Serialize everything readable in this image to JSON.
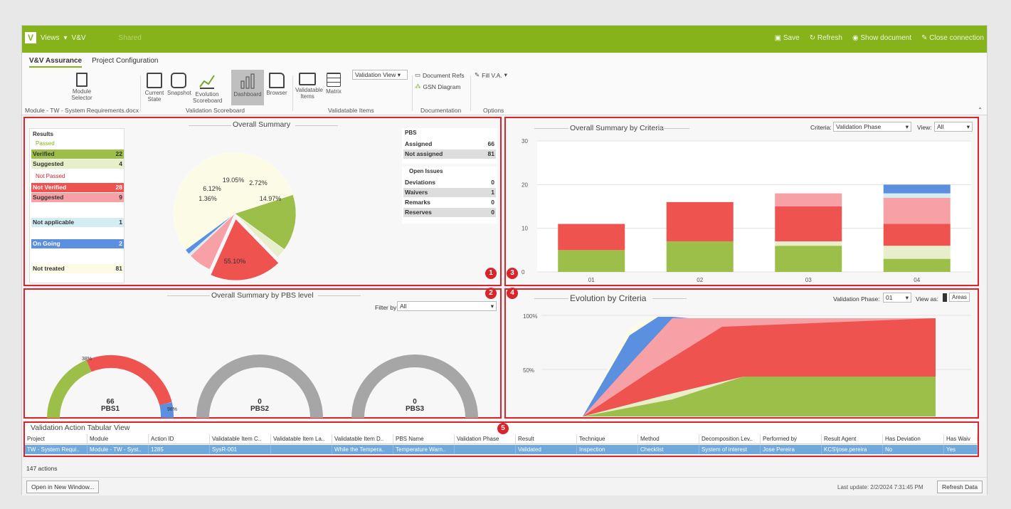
{
  "titlebar": {
    "app_menu": "Views",
    "context": "V&V",
    "shared": "Shared",
    "actions": [
      "Save",
      "Refresh",
      "Show document",
      "Close connection"
    ]
  },
  "ribbon": {
    "tabs": [
      "V&V Assurance",
      "Project Configuration"
    ],
    "module_selector": "Module Selector",
    "module_path": "Module - TW - System Requirements.docx",
    "scoreboard_buttons": [
      "Current State",
      "Snapshot",
      "Evolution Scoreboard",
      "Dashboard",
      "Browser"
    ],
    "scoreboard_group": "Validation Scoreboard",
    "items_buttons": [
      "Validatable Items",
      "Matrix"
    ],
    "items_dropdown": "Validation View",
    "items_group": "Validatable Items",
    "doc_buttons": [
      "Document Refs",
      "GSN Diagram"
    ],
    "doc_group": "Documentation",
    "options_button": "Fill V.A.",
    "options_group": "Options"
  },
  "panel1": {
    "title": "Overall Summary",
    "results_header": "Results",
    "passed_label": "Passed",
    "not_passed_label": "Not Passed",
    "rows": [
      {
        "label": "Verified",
        "value": "22",
        "color": "#9cbf4a"
      },
      {
        "label": "Suggested",
        "value": "4",
        "color": "#e6efc9"
      },
      {
        "label": "Not Verified",
        "value": "28",
        "color": "#ef5350"
      },
      {
        "label": "Suggested",
        "value": "9",
        "color": "#f7a0a6"
      },
      {
        "label": "Not applicable",
        "value": "1",
        "color": "#d4ecf3"
      },
      {
        "label": "On Going",
        "value": "2",
        "color": "#5b8fe0"
      },
      {
        "label": "Not treated",
        "value": "81",
        "color": "#fbfbe6"
      }
    ],
    "pie_labels": [
      "19.05%",
      "2.72%",
      "14.97%",
      "6.12%",
      "1.36%",
      "55.10%"
    ],
    "pbs_header": "PBS",
    "pbs_rows": [
      {
        "label": "Assigned",
        "value": "66"
      },
      {
        "label": "Not assigned",
        "value": "81"
      }
    ],
    "issues_header": "Open Issues",
    "issue_rows": [
      {
        "label": "Deviations",
        "value": "0"
      },
      {
        "label": "Waivers",
        "value": "1"
      },
      {
        "label": "Remarks",
        "value": "0"
      },
      {
        "label": "Reserves",
        "value": "0"
      }
    ]
  },
  "panel2": {
    "title": "Overall Summary by PBS level",
    "filter_label": "Filter by:",
    "filter_value": "All",
    "gauges": [
      {
        "value": "66",
        "name": "PBS1",
        "top_pct": "38%",
        "side_pct": "98%"
      },
      {
        "value": "0",
        "name": "PBS2"
      },
      {
        "value": "0",
        "name": "PBS3"
      }
    ]
  },
  "panel3": {
    "title": "Overall Summary by Criteria",
    "criteria_label": "Criteria:",
    "criteria_value": "Validation Phase",
    "view_label": "View:",
    "view_value": "All",
    "yticks": [
      "30",
      "20",
      "10",
      "0"
    ],
    "xcats": [
      "01",
      "02",
      "03",
      "04"
    ]
  },
  "panel4": {
    "title": "Evolution by Criteria",
    "phase_label": "Validation Phase:",
    "phase_value": "01",
    "viewas_label": "View as:",
    "viewas_value": "Areas",
    "yticks": [
      "100%",
      "50%"
    ]
  },
  "panel5": {
    "title": "Validation Action Tabular View",
    "columns": [
      "Project",
      "Module",
      "Action ID",
      "Validatable Item C..",
      "Validatable Item La..",
      "Validatable Item D..",
      "PBS Name",
      "Validation Phase",
      "Result",
      "Technique",
      "Method",
      "Decomposition Lev..",
      "Performed by",
      "Result Agent",
      "Has Deviation",
      "Has Waiv"
    ],
    "row": [
      "TW - System Requi..",
      "Module - TW - Syst..",
      "1285",
      "SysR-001",
      "",
      "While the Tempera..",
      "Temperature Warn..",
      "",
      "Validated",
      "Inspection",
      "Checklist",
      "System of interest",
      "Jose Pereira",
      "KCS\\jose.pereira",
      "No",
      "Yes"
    ],
    "count": "147 actions"
  },
  "badges": [
    "1",
    "2",
    "3",
    "4",
    "5"
  ],
  "footer": {
    "open_button": "Open in New Window...",
    "last_update": "Last update: 2/2/2024 7:31:45 PM",
    "refresh_button": "Refresh Data"
  },
  "chart_data": [
    {
      "type": "bar",
      "title": "Overall Summary by Criteria",
      "categories": [
        "01",
        "02",
        "03",
        "04"
      ],
      "ylim": [
        0,
        30
      ],
      "series": [
        {
          "values": [
            5,
            7,
            6,
            3
          ],
          "color": "#9cbf4a"
        },
        {
          "values": [
            0,
            0,
            1,
            3
          ],
          "color": "#e6efc9"
        },
        {
          "values": [
            6,
            9,
            8,
            5
          ],
          "color": "#ef5350"
        },
        {
          "values": [
            0,
            0,
            3,
            6
          ],
          "color": "#f7a0a6"
        },
        {
          "values": [
            0,
            0,
            0,
            1
          ],
          "color": "#d4ecf3"
        },
        {
          "values": [
            0,
            0,
            0,
            2
          ],
          "color": "#5b8fe0"
        }
      ]
    },
    {
      "type": "pie",
      "title": "Overall Summary",
      "slices": [
        {
          "label": "14.97%",
          "value": 14.97,
          "color": "#9cbf4a"
        },
        {
          "label": "2.72%",
          "value": 2.72,
          "color": "#e6efc9"
        },
        {
          "label": "19.05%",
          "value": 19.05,
          "color": "#ef5350"
        },
        {
          "label": "6.12%",
          "value": 6.12,
          "color": "#f7a0a6"
        },
        {
          "label": "",
          "value": 0.68,
          "color": "#d4ecf3"
        },
        {
          "label": "1.36%",
          "value": 1.36,
          "color": "#5b8fe0"
        },
        {
          "label": "55.10%",
          "value": 55.1,
          "color": "#fbfbe6"
        }
      ]
    }
  ]
}
